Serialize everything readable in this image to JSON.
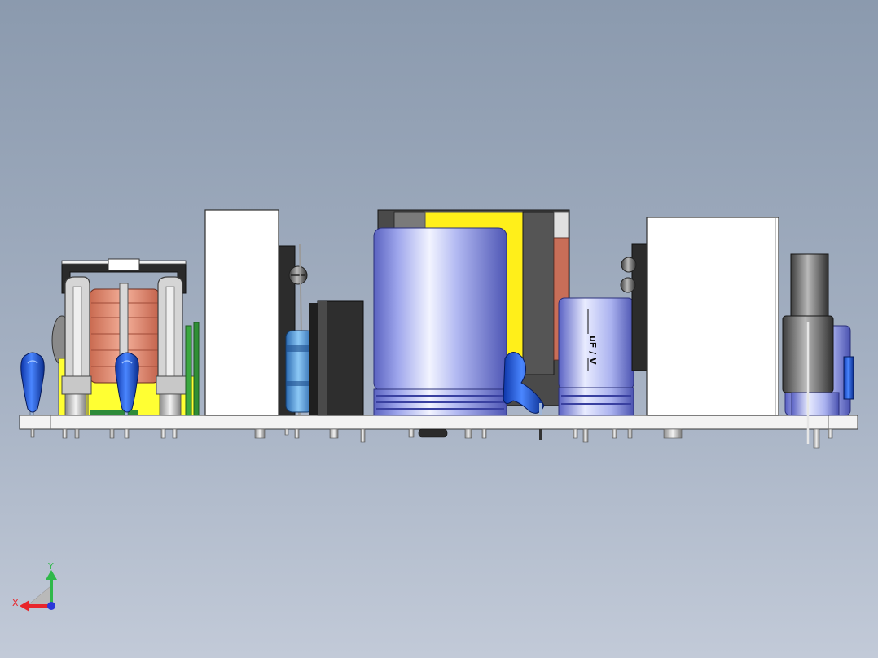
{
  "view": {
    "background_top": "#8b9aae",
    "background_bottom": "#c2cad8"
  },
  "model": {
    "capacitor_label": "uF / V"
  },
  "triad": {
    "x_label": "X",
    "y_label": "Y",
    "x_color": "#e8262b",
    "y_color": "#2fb84a",
    "z_color": "#2b38d9"
  }
}
